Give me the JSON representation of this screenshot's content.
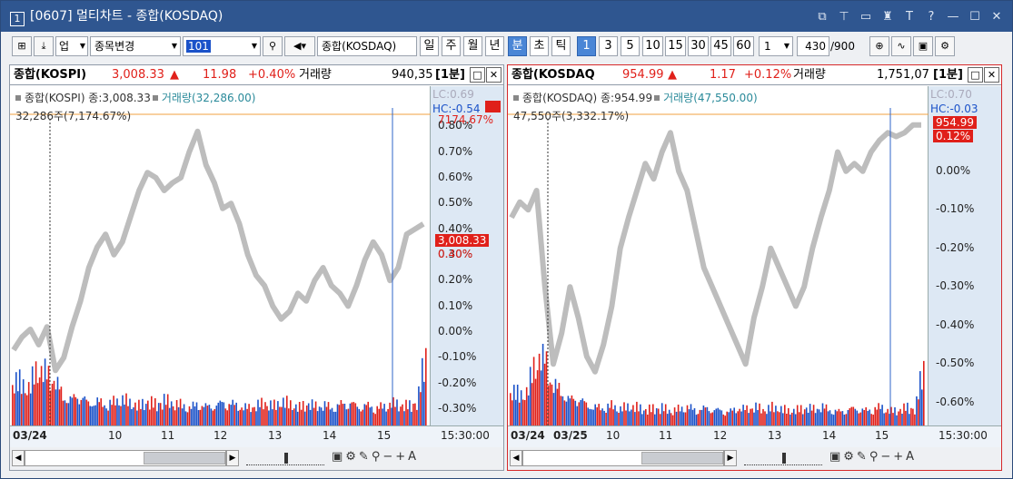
{
  "title": {
    "num": "1",
    "text": "[0607] 멀티차트 - 종합(KOSDAQ)"
  },
  "window_buttons": [
    "⧉",
    "⊤",
    "▭",
    "♜",
    "T",
    "?",
    "—",
    "☐",
    "✕"
  ],
  "toolbar": {
    "category": "업",
    "stock_change": "종목변경",
    "code": "101",
    "name_field": "종합(KOSDAQ)",
    "periods": [
      "일",
      "주",
      "월",
      "년",
      "분",
      "초",
      "틱"
    ],
    "intervals": [
      "1",
      "3",
      "5",
      "10",
      "15",
      "30",
      "45",
      "60"
    ],
    "count_select": "1",
    "range": "430",
    "range_total": "/900"
  },
  "panes": [
    {
      "name": "종합(KOSPI)",
      "price": "3,008.33",
      "arrow": "▲",
      "change": "11.98",
      "pct": "+0.40%",
      "vol_label": "거래량",
      "vol": "940,35",
      "period": "[1분]",
      "legend_main": "종합(KOSPI) 종:3,008.33",
      "legend_vol": "거래량(32,286.00)",
      "vol_note": "32,286주(7,174.67%)",
      "lc": "LC:0.69",
      "hc": "HC:-0.54",
      "top_pct": "7174.67%",
      "price_tag": "3,008.33",
      "price_pct": "0.40%",
      "yticks": [
        "0.80%",
        "0.70%",
        "0.60%",
        "0.50%",
        "0.40%",
        "0.30%",
        "0.20%",
        "0.10%",
        "0.00%",
        "-0.10%",
        "-0.20%",
        "-0.30%"
      ],
      "xticks": [
        "03/24",
        "10",
        "11",
        "12",
        "13",
        "14",
        "15"
      ],
      "time": "15:30:00"
    },
    {
      "name": "종합(KOSDAQ",
      "price": "954.99",
      "arrow": "▲",
      "change": "1.17",
      "pct": "+0.12%",
      "vol_label": "거래량",
      "vol": "1,751,07",
      "period": "[1분]",
      "legend_main": "종합(KOSDAQ) 종:954.99",
      "legend_vol": "거래량(47,550.00)",
      "vol_note": "47,550주(3,332.17%)",
      "lc": "LC:0.70",
      "hc": "HC:-0.03",
      "price_tag": "954.99",
      "price_pct": "0.12%",
      "yticks": [
        "0.00%",
        "-0.10%",
        "-0.20%",
        "-0.30%",
        "-0.40%",
        "-0.50%",
        "-0.60%"
      ],
      "xticks": [
        "03/24",
        "03/25",
        "10",
        "11",
        "12",
        "13",
        "14",
        "15"
      ],
      "time": "15:30:00"
    }
  ],
  "chart_data": [
    {
      "type": "line",
      "title": "종합(KOSPI) 1분",
      "ylabel": "%",
      "y_range": [
        -0.35,
        0.85
      ],
      "series": [
        {
          "name": "종합(KOSPI)",
          "values": [
            -0.07,
            -0.02,
            0.01,
            -0.05,
            0.02,
            -0.15,
            -0.1,
            0.02,
            0.12,
            0.25,
            0.33,
            0.38,
            0.3,
            0.35,
            0.45,
            0.55,
            0.62,
            0.6,
            0.55,
            0.58,
            0.6,
            0.7,
            0.78,
            0.65,
            0.58,
            0.48,
            0.5,
            0.42,
            0.3,
            0.22,
            0.18,
            0.1,
            0.05,
            0.08,
            0.15,
            0.12,
            0.2,
            0.25,
            0.18,
            0.15,
            0.1,
            0.18,
            0.28,
            0.35,
            0.3,
            0.2,
            0.25,
            0.38,
            0.4,
            0.42
          ]
        },
        {
          "name": "거래량",
          "values": [
            30,
            28,
            25,
            40,
            35,
            32,
            20,
            18,
            22,
            15,
            17,
            14,
            16,
            18,
            15,
            13,
            16,
            14,
            17,
            15,
            14,
            12,
            15,
            13,
            14,
            16,
            15,
            13,
            12,
            14,
            15,
            13,
            16,
            14,
            12,
            15,
            13,
            14,
            12,
            15,
            16,
            13,
            14,
            12,
            13,
            15,
            14,
            13,
            16,
            48
          ]
        }
      ]
    },
    {
      "type": "line",
      "title": "종합(KOSDAQ) 1분",
      "ylabel": "%",
      "y_range": [
        -0.65,
        0.15
      ],
      "series": [
        {
          "name": "종합(KOSDAQ)",
          "values": [
            -0.12,
            -0.08,
            -0.1,
            -0.05,
            -0.3,
            -0.5,
            -0.42,
            -0.3,
            -0.38,
            -0.48,
            -0.52,
            -0.45,
            -0.35,
            -0.2,
            -0.12,
            -0.05,
            0.02,
            -0.02,
            0.05,
            0.1,
            0.0,
            -0.05,
            -0.15,
            -0.25,
            -0.3,
            -0.35,
            -0.4,
            -0.45,
            -0.5,
            -0.38,
            -0.3,
            -0.2,
            -0.25,
            -0.3,
            -0.35,
            -0.3,
            -0.2,
            -0.12,
            -0.05,
            0.05,
            0.0,
            0.02,
            0.0,
            0.05,
            0.08,
            0.1,
            0.09,
            0.1,
            0.12,
            0.12
          ]
        },
        {
          "name": "거래량",
          "values": [
            30,
            25,
            28,
            55,
            60,
            35,
            30,
            22,
            25,
            18,
            16,
            15,
            17,
            14,
            16,
            15,
            13,
            14,
            15,
            12,
            14,
            16,
            13,
            15,
            14,
            13,
            12,
            15,
            14,
            16,
            13,
            15,
            14,
            12,
            13,
            15,
            14,
            16,
            13,
            12,
            14,
            15,
            13,
            14,
            16,
            12,
            13,
            15,
            14,
            50
          ]
        }
      ]
    }
  ],
  "colors": {
    "title_bg": "#2f5690",
    "up": "#e0201a",
    "down": "#1b52c9",
    "line": "#bdbdbd",
    "axis_bg": "#dde8f4",
    "hline": "#f0a040",
    "pane_active": "#d6282a"
  }
}
